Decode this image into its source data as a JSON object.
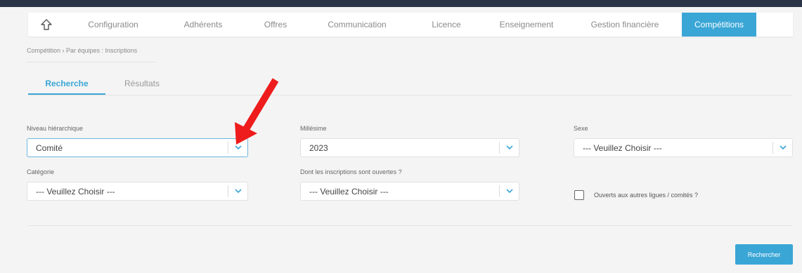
{
  "nav": {
    "home_icon": "home-icon",
    "items": [
      {
        "label": "Configuration"
      },
      {
        "label": "Adhérents"
      },
      {
        "label": "Offres"
      },
      {
        "label": "Communication"
      },
      {
        "label": "Licence"
      },
      {
        "label": "Enseignement"
      },
      {
        "label": "Gestion financière"
      },
      {
        "label": "Compétitions",
        "active": true
      }
    ]
  },
  "breadcrumb": "Compétition  › Par équipes : Inscriptions",
  "tabs": [
    {
      "label": "Recherche",
      "active": true
    },
    {
      "label": "Résultats",
      "active": false
    }
  ],
  "form": {
    "niveau": {
      "label": "Niveau hiérarchique",
      "value": "Comité"
    },
    "millesime": {
      "label": "Millésime",
      "value": "2023"
    },
    "sexe": {
      "label": "Sexe",
      "value": "--- Veuillez Choisir ---"
    },
    "categorie": {
      "label": "Catégorie",
      "value": "--- Veuillez Choisir ---"
    },
    "inscriptions": {
      "label": "Dont les inscriptions sont ouvertes ?",
      "value": "--- Veuillez Choisir ---"
    },
    "ouverts": {
      "label": "Ouverts aux autres ligues / comités ?",
      "checked": false
    }
  },
  "search_button": "Rechercher",
  "colors": {
    "accent": "#3aa6d6",
    "annotation_arrow": "#ee1c1c",
    "top_band": "#2a3547"
  }
}
